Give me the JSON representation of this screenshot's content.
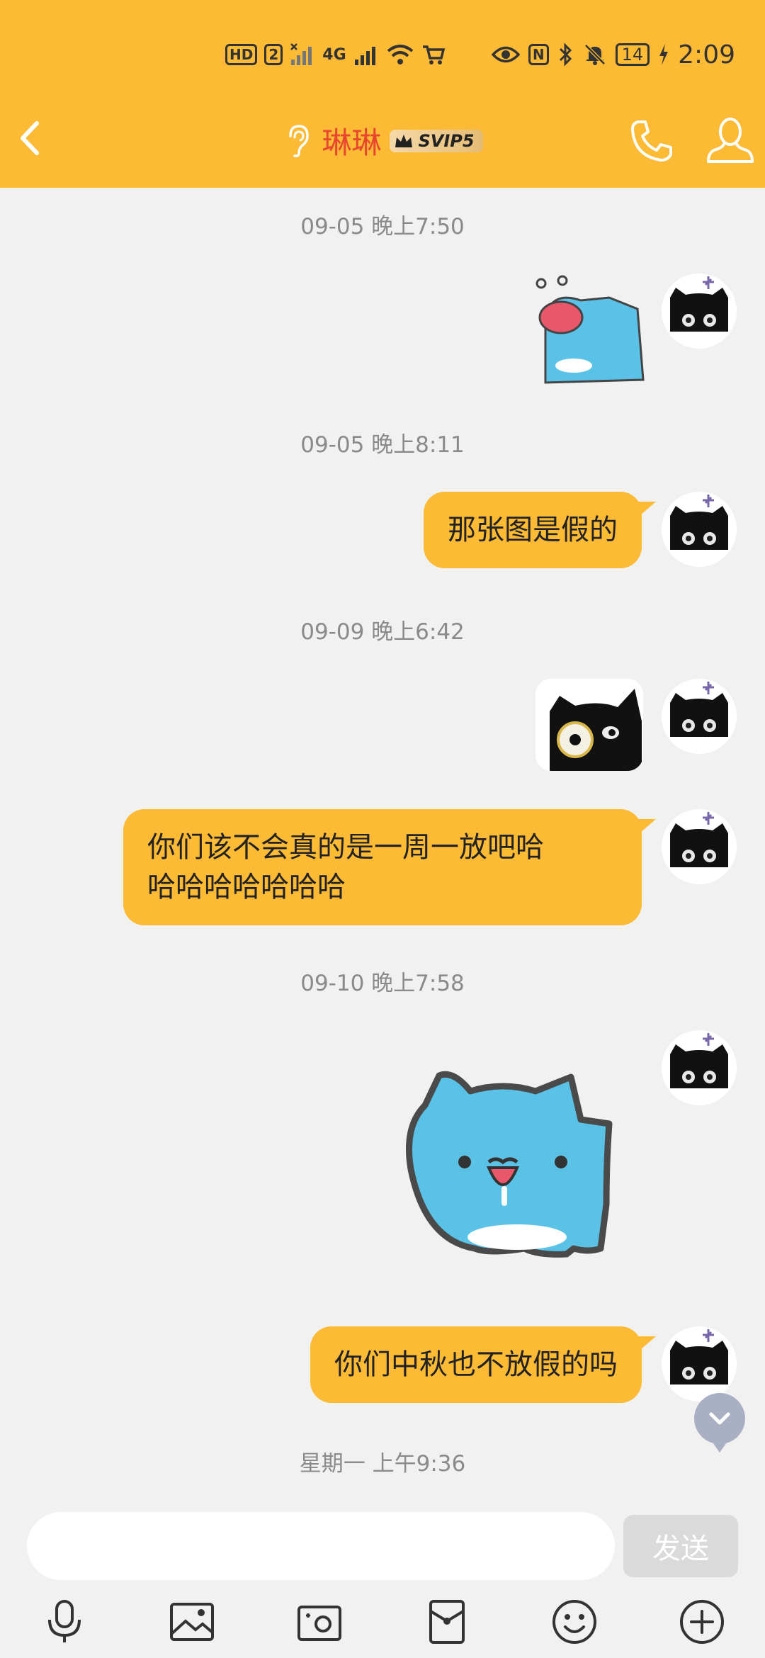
{
  "status_bar": {
    "hd": "HD",
    "sim": "2",
    "net": "4G",
    "battery": "14",
    "time": "2:09",
    "nfc": "N"
  },
  "header": {
    "title": "琳琳",
    "badge": "SVIP5"
  },
  "messages": [
    {
      "timestamp": "09-05 晚上7:50"
    },
    {
      "timestamp": "09-05 晚上8:11",
      "text": "那张图是假的"
    },
    {
      "timestamp": "09-09 晚上6:42"
    },
    {
      "text": "你们该不会真的是一周一放吧哈\n哈哈哈哈哈哈哈"
    },
    {
      "timestamp": "09-10 晚上7:58"
    },
    {
      "text": "你们中秋也不放假的吗"
    },
    {
      "timestamp": "星期一 上午9:36"
    }
  ],
  "input": {
    "placeholder": "",
    "send_label": "发送"
  },
  "colors": {
    "accent": "#fdbb35",
    "title": "#e8452f",
    "background": "#f1f1f1"
  },
  "icons": [
    "back-icon",
    "ear-icon",
    "phone-icon",
    "profile-icon",
    "mic-icon",
    "image-icon",
    "camera-icon",
    "red-packet-icon",
    "emoji-icon",
    "plus-icon",
    "chevron-down-icon"
  ]
}
